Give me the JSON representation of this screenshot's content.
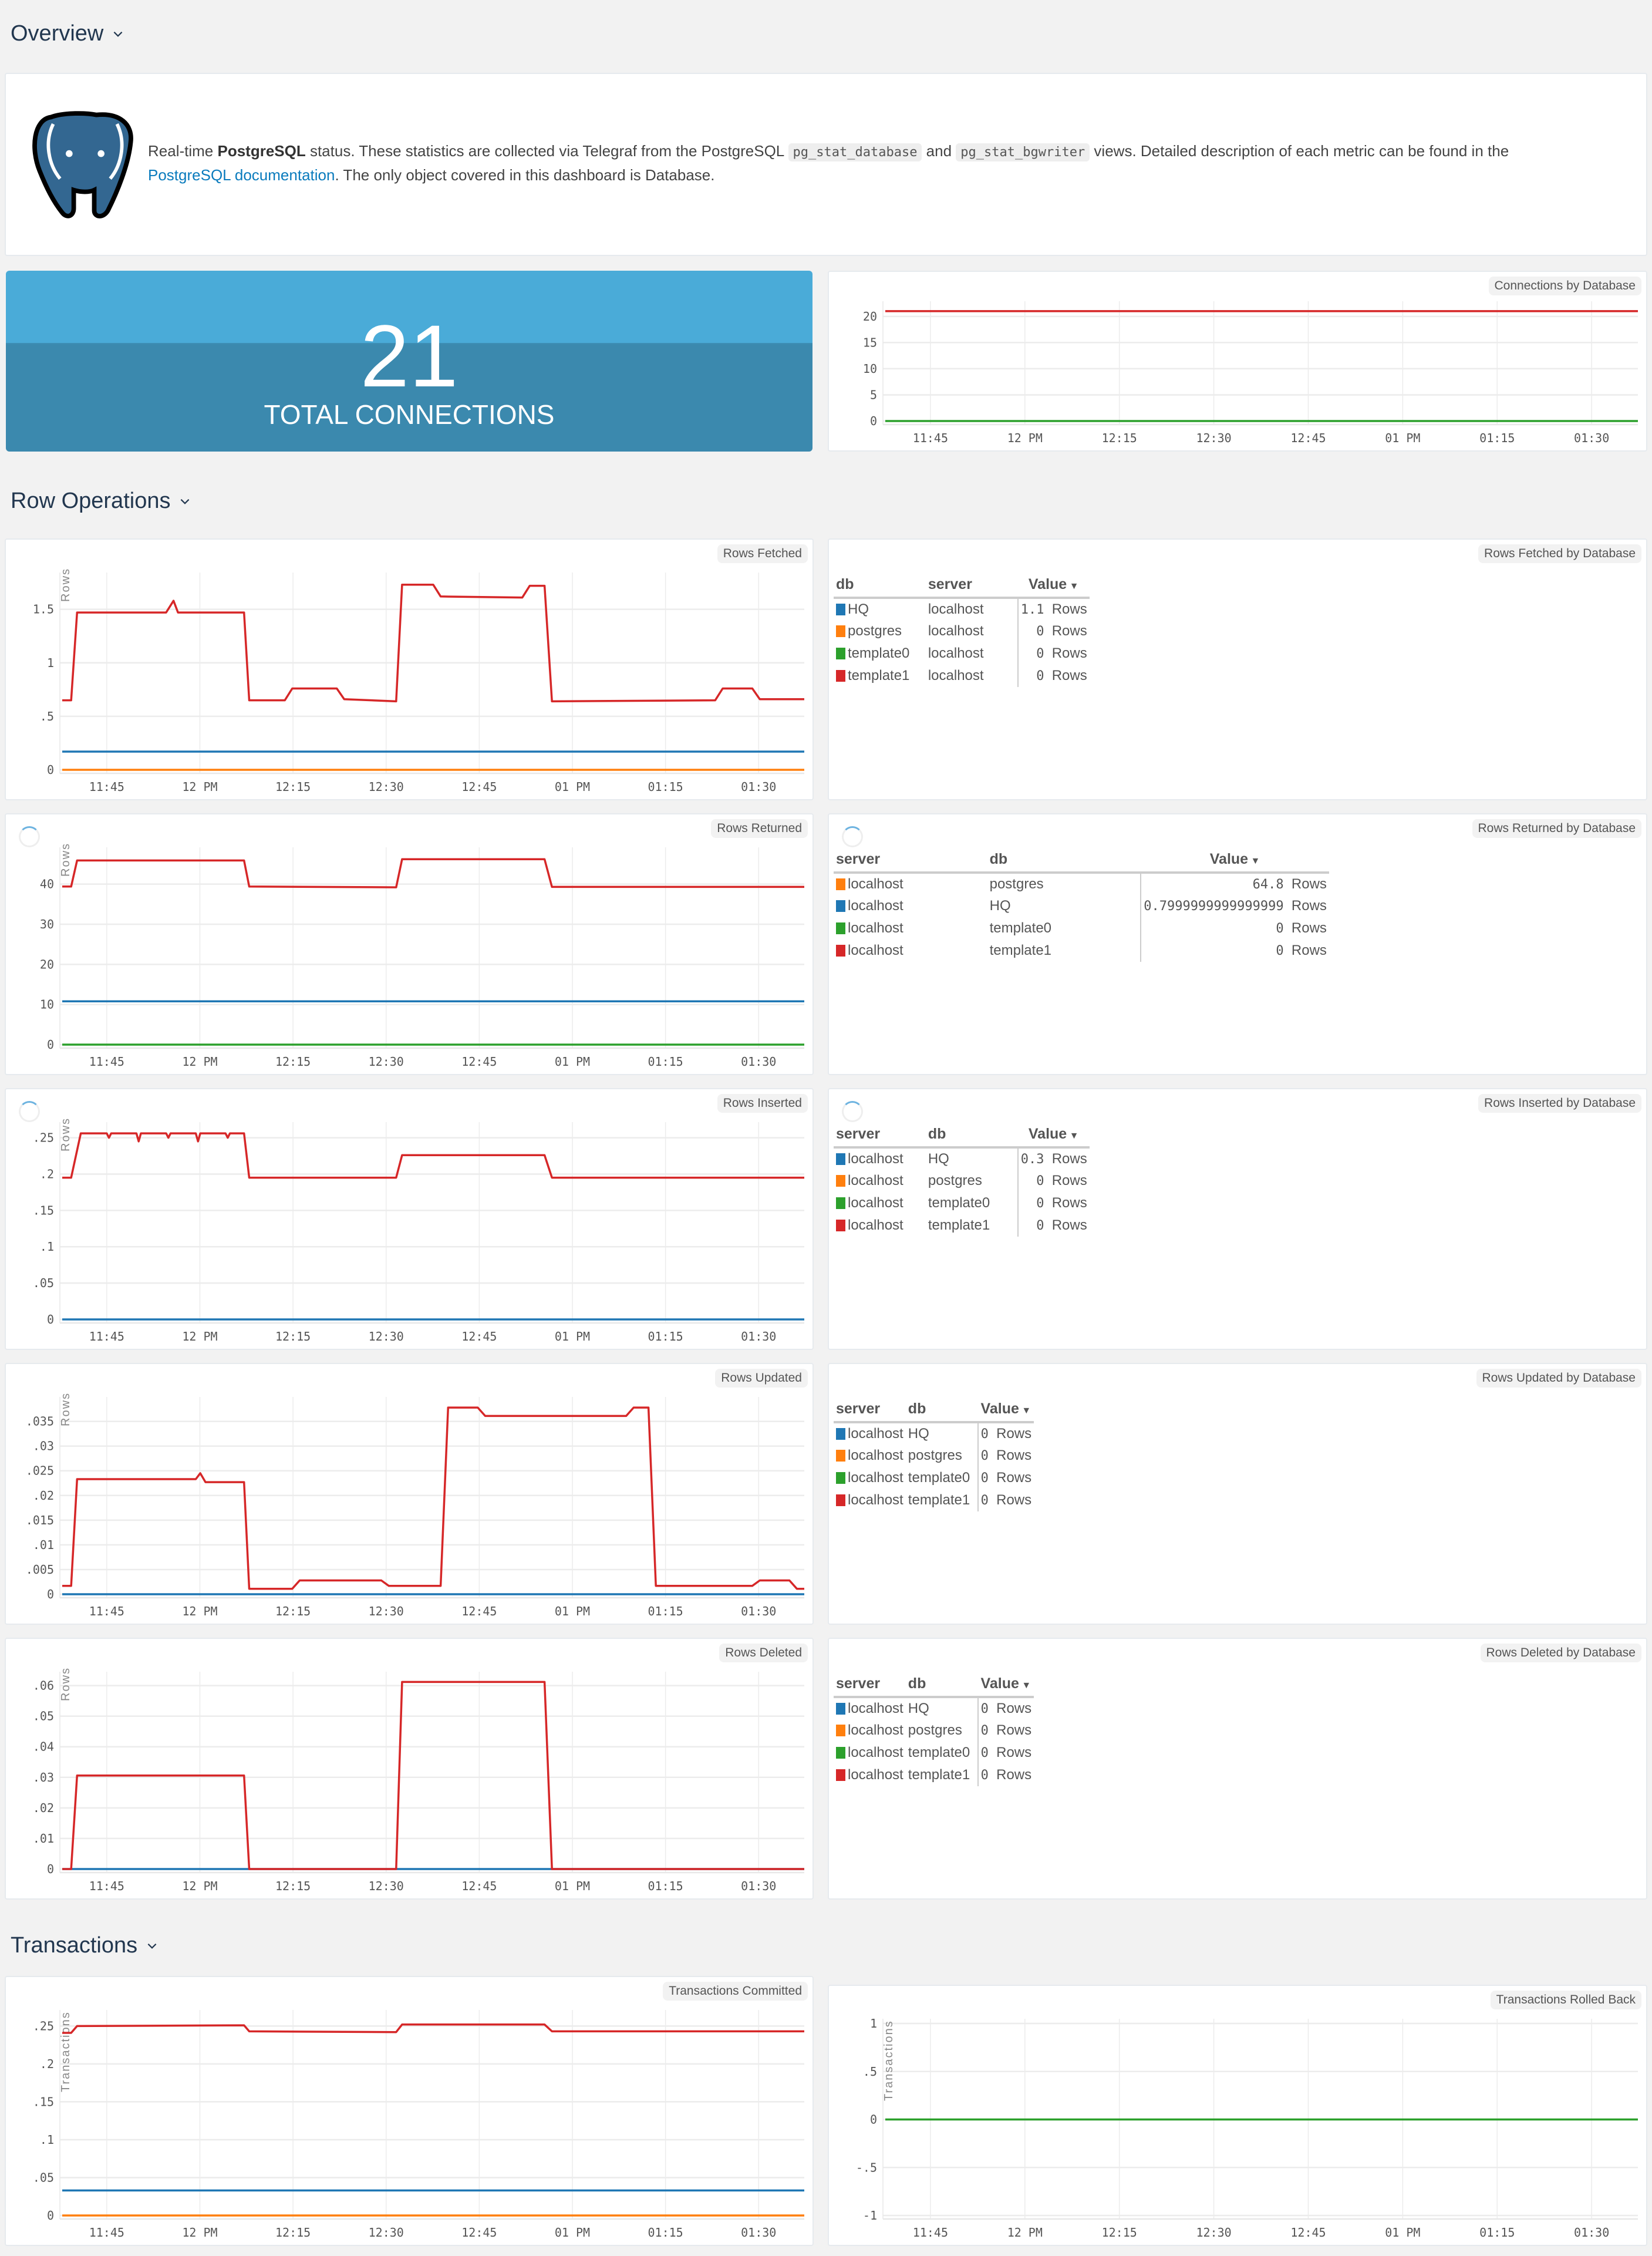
{
  "sections": {
    "overview": "Overview",
    "row_operations": "Row Operations",
    "transactions": "Transactions"
  },
  "intro": {
    "logo": "postgresql-elephant-logo",
    "text_1": "Real-time ",
    "bold": "PostgreSQL",
    "text_2": " status. These statistics are collected via Telegraf from the PostgreSQL ",
    "code_1": "pg_stat_database",
    "text_3": " and ",
    "code_2": "pg_stat_bgwriter",
    "text_4": " views. Detailed description of each metric can be found in the ",
    "link": "PostgreSQL documentation",
    "text_5": ". The only object covered in this dashboard is Database."
  },
  "stat": {
    "value": "21",
    "label": "TOTAL CONNECTIONS",
    "colors": {
      "top": "#4aabd8",
      "bottom": "#3b89ae"
    }
  },
  "series_colors": {
    "HQ": "#1f77b4",
    "postgres": "#ff7f0e",
    "template0": "#2ca02c",
    "template1": "#d62728"
  },
  "x_ticks": [
    "11:45",
    "12 PM",
    "12:15",
    "12:30",
    "12:45",
    "01 PM",
    "01:15",
    "01:30"
  ],
  "tables": [
    {
      "title": "Rows Fetched by Database",
      "columns": [
        "db",
        "server",
        "Value"
      ],
      "rows": [
        {
          "c1": "HQ",
          "c2": "localhost",
          "value": "1.1",
          "unit": "Rows",
          "color": "#1f77b4"
        },
        {
          "c1": "postgres",
          "c2": "localhost",
          "value": "0",
          "unit": "Rows",
          "color": "#ff7f0e"
        },
        {
          "c1": "template0",
          "c2": "localhost",
          "value": "0",
          "unit": "Rows",
          "color": "#2ca02c"
        },
        {
          "c1": "template1",
          "c2": "localhost",
          "value": "0",
          "unit": "Rows",
          "color": "#d62728"
        }
      ]
    },
    {
      "title": "Rows Returned by Database",
      "columns": [
        "server",
        "db",
        "Value"
      ],
      "rows": [
        {
          "c1": "localhost",
          "c2": "postgres",
          "value": "64.8",
          "unit": "Rows",
          "color": "#ff7f0e"
        },
        {
          "c1": "localhost",
          "c2": "HQ",
          "value": "0.7999999999999999",
          "unit": "Rows",
          "color": "#1f77b4"
        },
        {
          "c1": "localhost",
          "c2": "template0",
          "value": "0",
          "unit": "Rows",
          "color": "#2ca02c"
        },
        {
          "c1": "localhost",
          "c2": "template1",
          "value": "0",
          "unit": "Rows",
          "color": "#d62728"
        }
      ]
    },
    {
      "title": "Rows Inserted by Database",
      "columns": [
        "server",
        "db",
        "Value"
      ],
      "rows": [
        {
          "c1": "localhost",
          "c2": "HQ",
          "value": "0.3",
          "unit": "Rows",
          "color": "#1f77b4"
        },
        {
          "c1": "localhost",
          "c2": "postgres",
          "value": "0",
          "unit": "Rows",
          "color": "#ff7f0e"
        },
        {
          "c1": "localhost",
          "c2": "template0",
          "value": "0",
          "unit": "Rows",
          "color": "#2ca02c"
        },
        {
          "c1": "localhost",
          "c2": "template1",
          "value": "0",
          "unit": "Rows",
          "color": "#d62728"
        }
      ]
    },
    {
      "title": "Rows Updated by Database",
      "columns": [
        "server",
        "db",
        "Value"
      ],
      "rows": [
        {
          "c1": "localhost",
          "c2": "HQ",
          "value": "0",
          "unit": "Rows",
          "color": "#1f77b4"
        },
        {
          "c1": "localhost",
          "c2": "postgres",
          "value": "0",
          "unit": "Rows",
          "color": "#ff7f0e"
        },
        {
          "c1": "localhost",
          "c2": "template0",
          "value": "0",
          "unit": "Rows",
          "color": "#2ca02c"
        },
        {
          "c1": "localhost",
          "c2": "template1",
          "value": "0",
          "unit": "Rows",
          "color": "#d62728"
        }
      ]
    },
    {
      "title": "Rows Deleted by Database",
      "columns": [
        "server",
        "db",
        "Value"
      ],
      "rows": [
        {
          "c1": "localhost",
          "c2": "HQ",
          "value": "0",
          "unit": "Rows",
          "color": "#1f77b4"
        },
        {
          "c1": "localhost",
          "c2": "postgres",
          "value": "0",
          "unit": "Rows",
          "color": "#ff7f0e"
        },
        {
          "c1": "localhost",
          "c2": "template0",
          "value": "0",
          "unit": "Rows",
          "color": "#2ca02c"
        },
        {
          "c1": "localhost",
          "c2": "template1",
          "value": "0",
          "unit": "Rows",
          "color": "#d62728"
        }
      ]
    }
  ],
  "chart_data": [
    {
      "id": "connections",
      "type": "line",
      "title": "Connections by Database",
      "ylabel": "",
      "ylim": [
        0,
        22
      ],
      "yticks": [
        0,
        5,
        10,
        15,
        20
      ],
      "ytick_labels": [
        "0",
        "5",
        "10",
        "15",
        "20"
      ],
      "xlim": [
        0,
        100
      ],
      "x_tick_positions": [
        0,
        15,
        30,
        45,
        60,
        75,
        90,
        105
      ],
      "x_offset": 7,
      "series": [
        {
          "name": "template1",
          "color": "#d62728",
          "points": [
            [
              0,
              21
            ],
            [
              100,
              21
            ]
          ]
        },
        {
          "name": "template0",
          "color": "#2ca02c",
          "points": [
            [
              0,
              0
            ],
            [
              100,
              0
            ]
          ]
        }
      ]
    },
    {
      "id": "rows_fetched",
      "type": "line",
      "title": "Rows Fetched",
      "ylabel": "Rows",
      "ylim": [
        0,
        1.8
      ],
      "yticks": [
        0,
        0.5,
        1,
        1.5
      ],
      "ytick_labels": [
        "0",
        ".5",
        "1",
        "1.5"
      ],
      "series": [
        {
          "name": "template1",
          "color": "#d62728",
          "points": [
            [
              0,
              0.65
            ],
            [
              1.2,
              0.65
            ],
            [
              2,
              1.47
            ],
            [
              14,
              1.47
            ],
            [
              15,
              1.58
            ],
            [
              15.6,
              1.47
            ],
            [
              24.5,
              1.47
            ],
            [
              25.2,
              0.65
            ],
            [
              30,
              0.65
            ],
            [
              31,
              0.76
            ],
            [
              37,
              0.76
            ],
            [
              38,
              0.66
            ],
            [
              45,
              0.64
            ],
            [
              45.8,
              1.73
            ],
            [
              50,
              1.73
            ],
            [
              51,
              1.62
            ],
            [
              62,
              1.61
            ],
            [
              63,
              1.72
            ],
            [
              65,
              1.72
            ],
            [
              66,
              0.64
            ],
            [
              88,
              0.65
            ],
            [
              89,
              0.76
            ],
            [
              93,
              0.76
            ],
            [
              94,
              0.66
            ],
            [
              100,
              0.66
            ]
          ]
        },
        {
          "name": "HQ",
          "color": "#1f77b4",
          "points": [
            [
              0,
              0.17
            ],
            [
              100,
              0.17
            ]
          ]
        },
        {
          "name": "postgres",
          "color": "#ff7f0e",
          "points": [
            [
              0,
              0
            ],
            [
              100,
              0
            ]
          ]
        }
      ]
    },
    {
      "id": "rows_returned",
      "type": "line",
      "title": "Rows Returned",
      "ylabel": "Rows",
      "ylim": [
        0,
        48
      ],
      "yticks": [
        0,
        10,
        20,
        30,
        40
      ],
      "ytick_labels": [
        "0",
        "10",
        "20",
        "30",
        "40"
      ],
      "series": [
        {
          "name": "template1",
          "color": "#d62728",
          "points": [
            [
              0,
              39.4
            ],
            [
              1.2,
              39.4
            ],
            [
              2,
              45.9
            ],
            [
              24.5,
              45.9
            ],
            [
              25.2,
              39.4
            ],
            [
              45,
              39.2
            ],
            [
              45.8,
              46.2
            ],
            [
              65,
              46.2
            ],
            [
              66,
              39.3
            ],
            [
              100,
              39.3
            ]
          ]
        },
        {
          "name": "HQ",
          "color": "#1f77b4",
          "points": [
            [
              0,
              10.8
            ],
            [
              100,
              10.8
            ]
          ]
        },
        {
          "name": "template0",
          "color": "#2ca02c",
          "points": [
            [
              0,
              0
            ],
            [
              100,
              0
            ]
          ]
        }
      ]
    },
    {
      "id": "rows_inserted",
      "type": "line",
      "title": "Rows Inserted",
      "ylabel": "Rows",
      "ylim": [
        0,
        0.265
      ],
      "yticks": [
        0,
        0.05,
        0.1,
        0.15,
        0.2,
        0.25
      ],
      "ytick_labels": [
        "0",
        ".05",
        ".1",
        ".15",
        ".2",
        ".25"
      ],
      "series": [
        {
          "name": "template1",
          "color": "#d62728",
          "points": [
            [
              0,
              0.195
            ],
            [
              1.2,
              0.195
            ],
            [
              2.5,
              0.256
            ],
            [
              6,
              0.256
            ],
            [
              6.3,
              0.25
            ],
            [
              6.6,
              0.256
            ],
            [
              10,
              0.256
            ],
            [
              10.3,
              0.245
            ],
            [
              10.6,
              0.256
            ],
            [
              14,
              0.256
            ],
            [
              14.3,
              0.25
            ],
            [
              14.6,
              0.256
            ],
            [
              18,
              0.256
            ],
            [
              18.3,
              0.245
            ],
            [
              18.6,
              0.256
            ],
            [
              22,
              0.256
            ],
            [
              22.3,
              0.25
            ],
            [
              22.6,
              0.256
            ],
            [
              24.5,
              0.256
            ],
            [
              25.2,
              0.195
            ],
            [
              45,
              0.195
            ],
            [
              45.8,
              0.226
            ],
            [
              65,
              0.226
            ],
            [
              66,
              0.195
            ],
            [
              100,
              0.195
            ]
          ]
        },
        {
          "name": "HQ",
          "color": "#1f77b4",
          "points": [
            [
              0,
              0
            ],
            [
              100,
              0
            ]
          ]
        }
      ]
    },
    {
      "id": "rows_updated",
      "type": "line",
      "title": "Rows Updated",
      "ylabel": "Rows",
      "ylim": [
        0,
        0.039
      ],
      "yticks": [
        0,
        0.005,
        0.01,
        0.015,
        0.02,
        0.025,
        0.03,
        0.035
      ],
      "ytick_labels": [
        "0",
        ".005",
        ".01",
        ".015",
        ".02",
        ".025",
        ".03",
        ".035"
      ],
      "series": [
        {
          "name": "template1",
          "color": "#d62728",
          "points": [
            [
              0,
              0.0017
            ],
            [
              1.2,
              0.0017
            ],
            [
              2,
              0.0233
            ],
            [
              18,
              0.0233
            ],
            [
              18.6,
              0.0245
            ],
            [
              19.3,
              0.0227
            ],
            [
              24.5,
              0.0227
            ],
            [
              25.2,
              0.0011
            ],
            [
              31,
              0.0011
            ],
            [
              32,
              0.0028
            ],
            [
              43,
              0.0028
            ],
            [
              44,
              0.0017
            ],
            [
              51,
              0.0017
            ],
            [
              52,
              0.0378
            ],
            [
              56,
              0.0378
            ],
            [
              57,
              0.0361
            ],
            [
              76,
              0.0361
            ],
            [
              77,
              0.0378
            ],
            [
              79,
              0.0378
            ],
            [
              80,
              0.0017
            ],
            [
              93,
              0.0017
            ],
            [
              94,
              0.0028
            ],
            [
              98,
              0.0028
            ],
            [
              99,
              0.0011
            ],
            [
              100,
              0.0011
            ]
          ]
        },
        {
          "name": "HQ",
          "color": "#1f77b4",
          "points": [
            [
              0,
              0
            ],
            [
              100,
              0
            ]
          ]
        }
      ]
    },
    {
      "id": "rows_deleted",
      "type": "line",
      "title": "Rows Deleted",
      "ylabel": "Rows",
      "ylim": [
        0,
        0.063
      ],
      "yticks": [
        0,
        0.01,
        0.02,
        0.03,
        0.04,
        0.05,
        0.06
      ],
      "ytick_labels": [
        "0",
        ".01",
        ".02",
        ".03",
        ".04",
        ".05",
        ".06"
      ],
      "series": [
        {
          "name": "HQ",
          "color": "#1f77b4",
          "points": [
            [
              0,
              0
            ],
            [
              100,
              0
            ]
          ]
        },
        {
          "name": "template1",
          "color": "#d62728",
          "points": [
            [
              0,
              0
            ],
            [
              1.2,
              0
            ],
            [
              2,
              0.0306
            ],
            [
              24.5,
              0.0306
            ],
            [
              25.2,
              0
            ],
            [
              45,
              0
            ],
            [
              45.8,
              0.0612
            ],
            [
              65,
              0.0612
            ],
            [
              66,
              0
            ],
            [
              100,
              0
            ]
          ]
        }
      ]
    },
    {
      "id": "transactions_committed",
      "type": "line",
      "title": "Transactions Committed",
      "ylabel": "Transactions",
      "ylim": [
        0,
        0.265
      ],
      "yticks": [
        0,
        0.05,
        0.1,
        0.15,
        0.2,
        0.25
      ],
      "ytick_labels": [
        "0",
        ".05",
        ".1",
        ".15",
        ".2",
        ".25"
      ],
      "series": [
        {
          "name": "template1",
          "color": "#d62728",
          "points": [
            [
              0,
              0.241
            ],
            [
              1.2,
              0.241
            ],
            [
              2,
              0.25
            ],
            [
              24.5,
              0.251
            ],
            [
              25.2,
              0.243
            ],
            [
              45,
              0.242
            ],
            [
              45.8,
              0.252
            ],
            [
              65,
              0.252
            ],
            [
              66,
              0.243
            ],
            [
              100,
              0.243
            ]
          ]
        },
        {
          "name": "HQ",
          "color": "#1f77b4",
          "points": [
            [
              0,
              0.033
            ],
            [
              100,
              0.033
            ]
          ]
        },
        {
          "name": "postgres",
          "color": "#ff7f0e",
          "points": [
            [
              0,
              0
            ],
            [
              100,
              0
            ]
          ]
        }
      ]
    },
    {
      "id": "transactions_rolled_back",
      "type": "line",
      "title": "Transactions Rolled Back",
      "ylabel": "Transactions",
      "ylim": [
        -1,
        1
      ],
      "yticks": [
        -1,
        -0.5,
        0,
        0.5,
        1
      ],
      "ytick_labels": [
        "-1",
        "-.5",
        "0",
        ".5",
        "1"
      ],
      "series": [
        {
          "name": "template0",
          "color": "#2ca02c",
          "points": [
            [
              0,
              0
            ],
            [
              100,
              0
            ]
          ]
        }
      ]
    }
  ]
}
